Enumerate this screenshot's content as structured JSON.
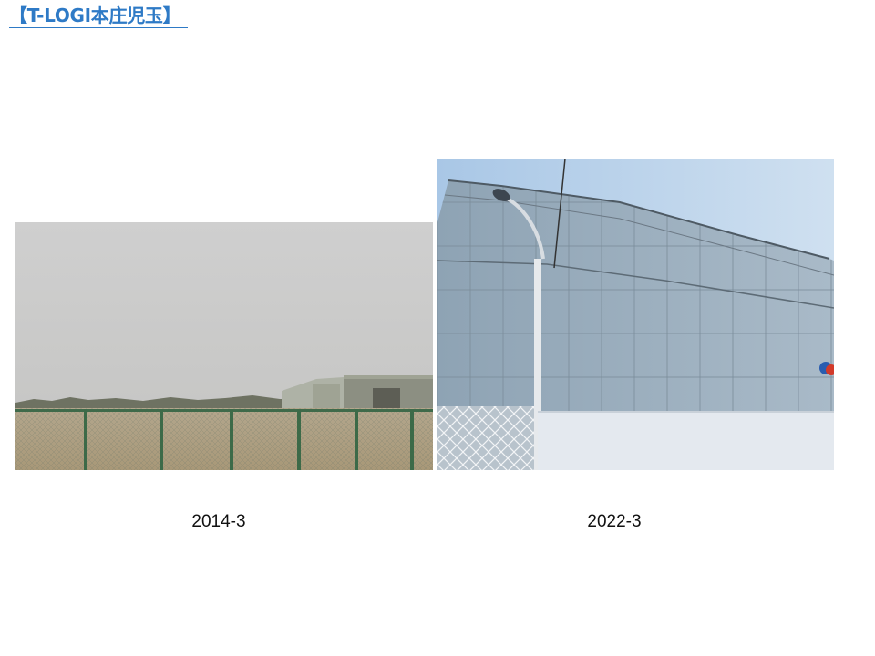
{
  "header": {
    "title": "【T-LOGI本庄児玉】"
  },
  "photos": [
    {
      "caption": "2014-3",
      "content": "empty-field-fence-photo"
    },
    {
      "caption": "2022-3",
      "content": "building-under-construction-photo"
    }
  ]
}
